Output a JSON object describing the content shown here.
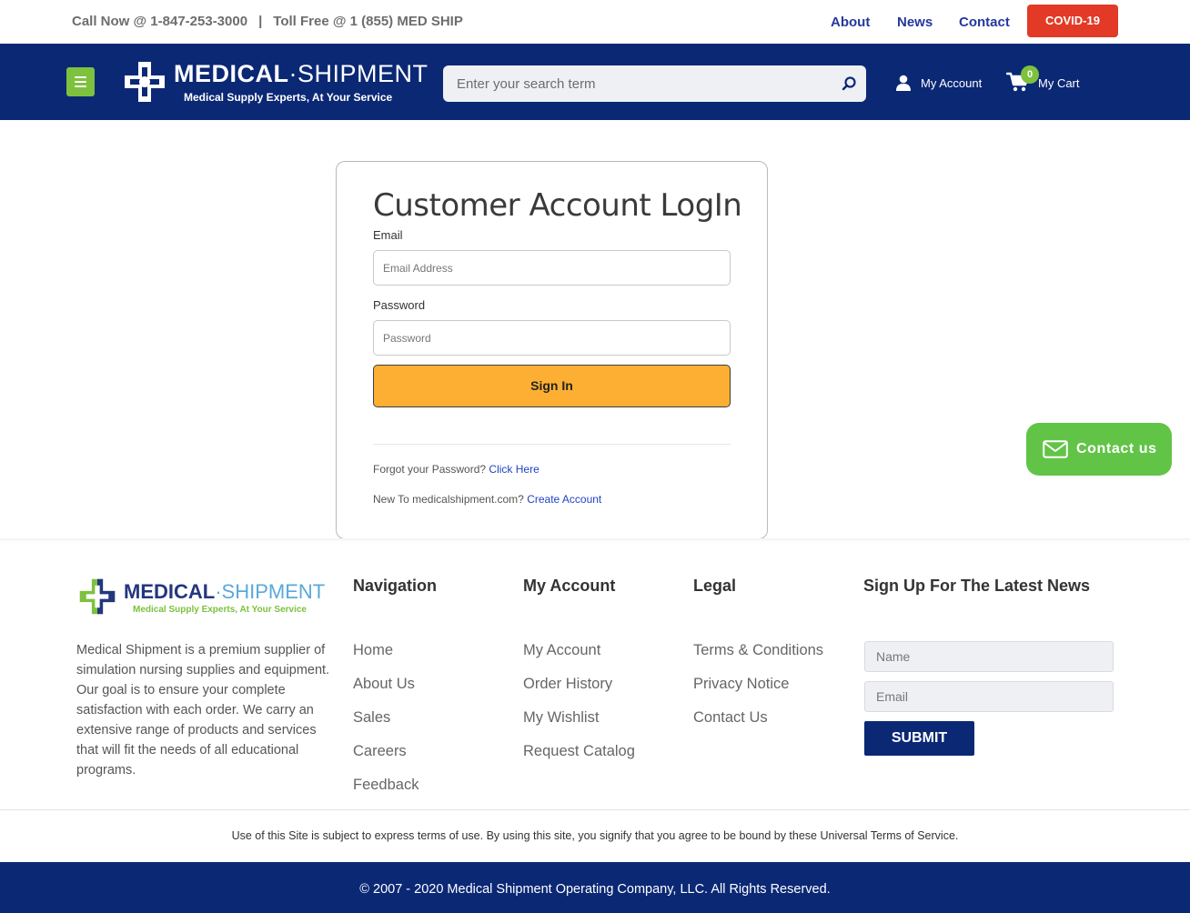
{
  "topbar": {
    "call_now": "Call Now @ 1-847-253-3000",
    "separator": "|",
    "toll_free": "Toll Free @ 1 (855) MED SHIP",
    "links": [
      "About",
      "News",
      "Contact"
    ],
    "covid_label": "COVID-19"
  },
  "header": {
    "logo_title_bold": "MEDICAL",
    "logo_title_dot": "·",
    "logo_title_thin": "SHIPMENT",
    "logo_tagline": "Medical Supply Experts, At Your Service",
    "search_placeholder": "Enter your search term",
    "account_label": "My Account",
    "cart_count": "0",
    "cart_label": "My Cart"
  },
  "login": {
    "title": "Customer Account LogIn",
    "email_label": "Email",
    "email_placeholder": "Email Address",
    "password_label": "Password",
    "password_placeholder": "Password",
    "signin_label": "Sign In",
    "forgot_text": "Forgot your Password?",
    "forgot_link": "Click Here",
    "new_text": "New To medicalshipment.com?",
    "create_link": "Create Account"
  },
  "contact_float": {
    "label": "Contact us"
  },
  "footer": {
    "logo_title_bold": "MEDICAL",
    "logo_title_dot": "·",
    "logo_title_thin": "SHIPMENT",
    "logo_tagline": "Medical Supply Experts, At Your Service",
    "about": "Medical Shipment is a premium supplier of simulation nursing supplies and equipment. Our goal is to ensure your complete satisfaction with each order. We carry an extensive range of products and services that will fit the needs of all educational programs.",
    "navigation": {
      "heading": "Navigation",
      "items": [
        "Home",
        "About Us",
        "Sales",
        "Careers",
        "Feedback"
      ]
    },
    "my_account": {
      "heading": "My Account",
      "items": [
        "My Account",
        "Order History",
        "My Wishlist",
        "Request Catalog"
      ]
    },
    "legal": {
      "heading": "Legal",
      "items": [
        "Terms & Conditions",
        "Privacy Notice",
        "Contact Us"
      ]
    },
    "newsletter": {
      "heading": "Sign Up For The Latest News",
      "name_placeholder": "Name",
      "email_placeholder": "Email",
      "submit_label": "SUBMIT"
    },
    "terms": "Use of this Site is subject to express terms of use. By using this site, you signify that you agree to be bound by these Universal Terms of Service.",
    "copyright": "© 2007 - 2020 Medical Shipment Operating Company, LLC. All Rights Reserved."
  },
  "colors": {
    "brand_navy": "#0b2875",
    "accent_green": "#7dc13e",
    "covid_red": "#e23a26",
    "signin_orange": "#fcaf32",
    "link_blue": "#2243c2"
  }
}
